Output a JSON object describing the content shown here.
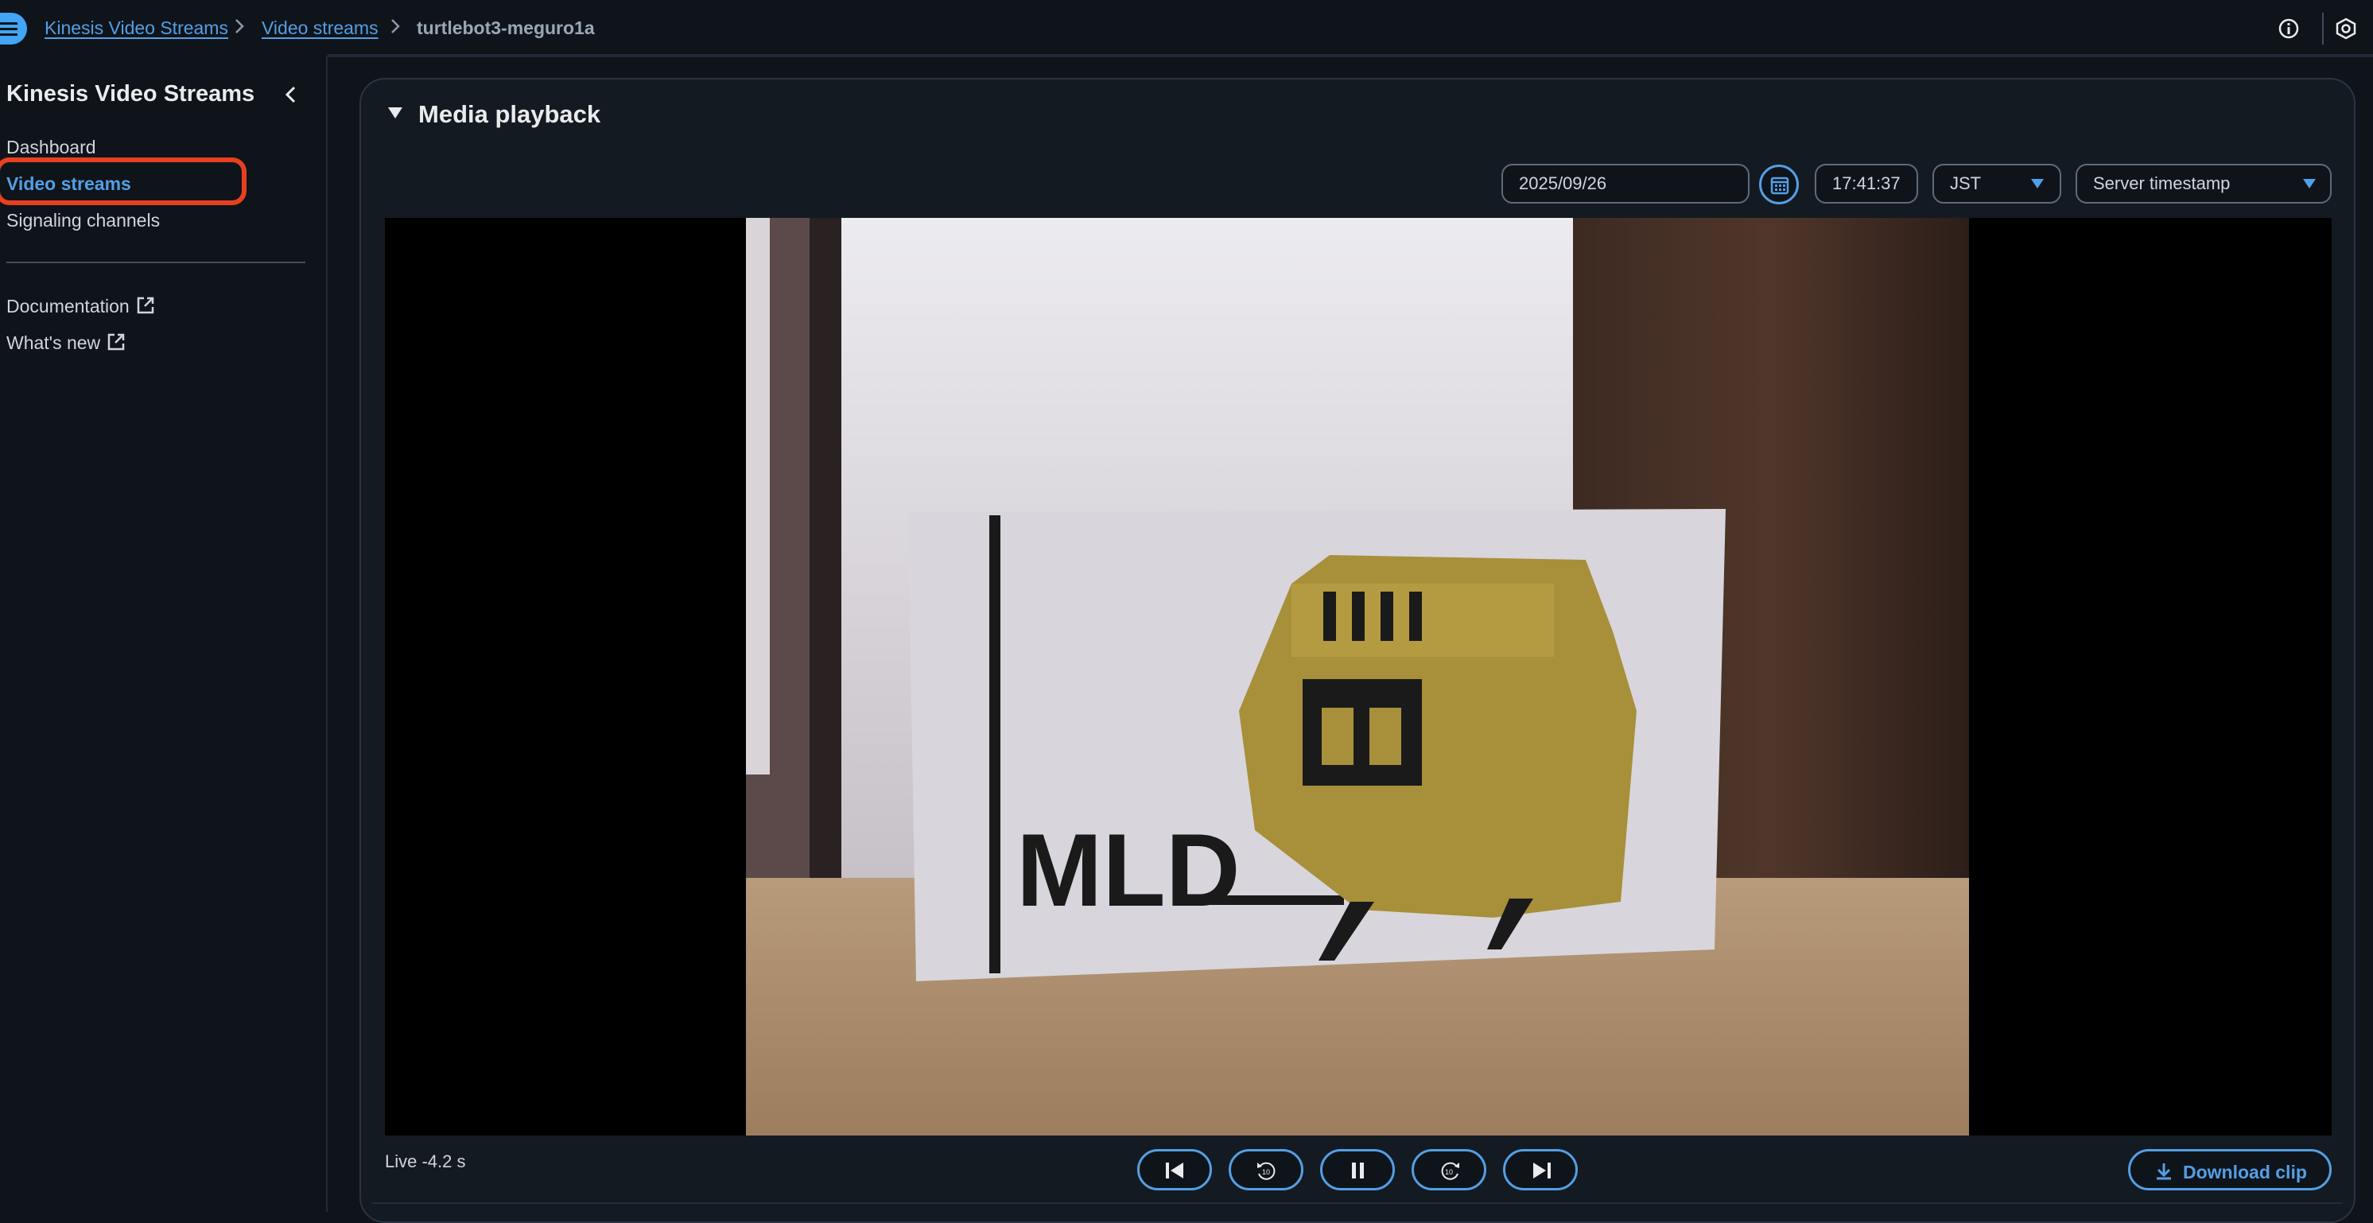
{
  "breadcrumb": {
    "items": [
      {
        "label": "Kinesis Video Streams"
      },
      {
        "label": "Video streams"
      },
      {
        "label": "turtlebot3-meguro1a"
      }
    ]
  },
  "sidebar": {
    "title": "Kinesis Video Streams",
    "items": [
      {
        "label": "Dashboard",
        "active": false
      },
      {
        "label": "Video streams",
        "active": true
      },
      {
        "label": "Signaling channels",
        "active": false
      }
    ],
    "links": [
      {
        "label": "Documentation"
      },
      {
        "label": "What's new"
      }
    ]
  },
  "panel": {
    "title": "Media playback",
    "date": "2025/09/26",
    "time": "17:41:37",
    "timezone": "JST",
    "timestamp_type": "Server timestamp"
  },
  "player": {
    "live_status": "Live -4.2 s",
    "download_label": "Download clip",
    "controls": [
      "skip-back-icon",
      "rewind-10-icon",
      "pause-icon",
      "forward-10-icon",
      "skip-forward-icon"
    ]
  },
  "colors": {
    "accent": "#539fe5",
    "highlight": "#e8401f",
    "background": "#0f141a"
  }
}
